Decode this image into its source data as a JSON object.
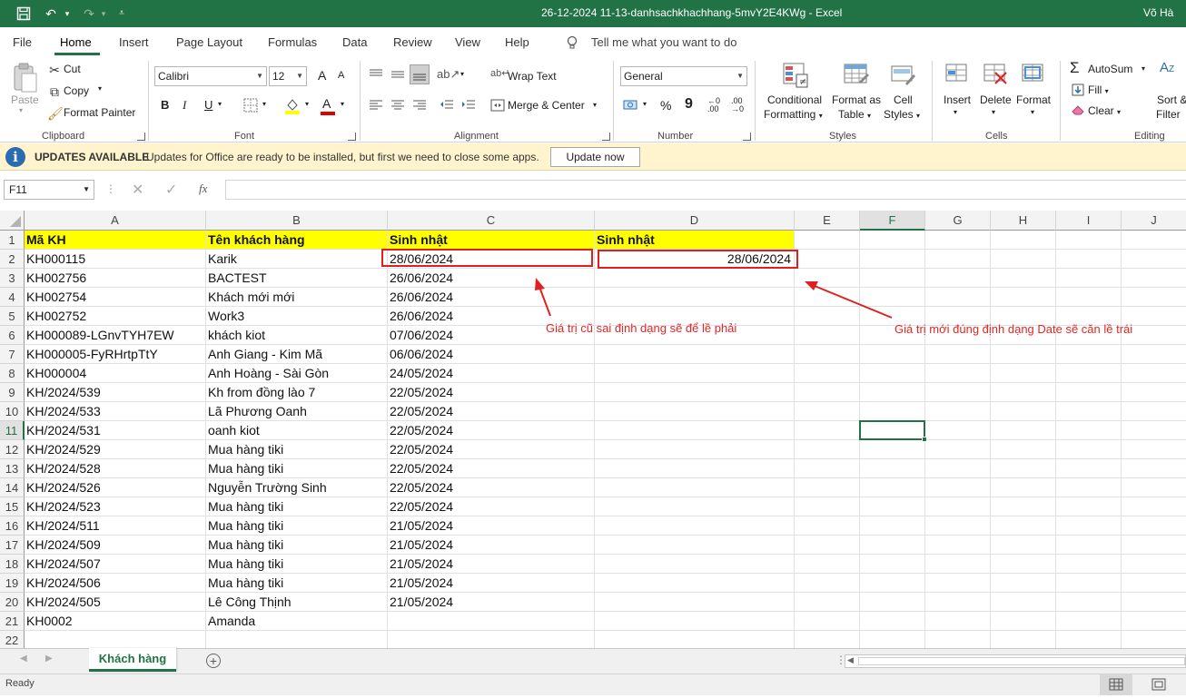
{
  "window": {
    "title": "26-12-2024 11-13-danhsachkhachhang-5mvY2E4KWg  -  Excel",
    "user": "Võ Hà"
  },
  "tabs": [
    "File",
    "Home",
    "Insert",
    "Page Layout",
    "Formulas",
    "Data",
    "Review",
    "View",
    "Help"
  ],
  "tell_me": "Tell me what you want to do",
  "ribbon": {
    "clipboard": {
      "paste": "Paste",
      "cut": "Cut",
      "copy": "Copy",
      "format_painter": "Format Painter",
      "group": "Clipboard"
    },
    "font": {
      "name": "Calibri",
      "size": "12",
      "bold": "B",
      "italic": "I",
      "underline": "U",
      "grow": "A",
      "shrink": "A",
      "color_glyph": "A",
      "group": "Font"
    },
    "alignment": {
      "wrap_text": "Wrap Text",
      "merge_center": "Merge & Center",
      "group": "Alignment"
    },
    "number": {
      "format": "General",
      "percent": "%",
      "comma": "9",
      "group": "Number"
    },
    "styles": {
      "conditional_formatting_1": "Conditional",
      "conditional_formatting_2": "Formatting",
      "format_as_table_1": "Format as",
      "format_as_table_2": "Table",
      "cell_styles_1": "Cell",
      "cell_styles_2": "Styles",
      "group": "Styles"
    },
    "cells": {
      "insert": "Insert",
      "delete": "Delete",
      "format": "Format",
      "group": "Cells"
    },
    "editing": {
      "autosum": "AutoSum",
      "fill": "Fill",
      "clear": "Clear",
      "sort_1": "Sort &",
      "sort_2": "Filter",
      "group": "Editing"
    }
  },
  "update_bar": {
    "title": "UPDATES AVAILABLE",
    "message": "Updates for Office are ready to be installed, but first we need to close some apps.",
    "button": "Update now"
  },
  "formula_bar": {
    "name_box": "F11",
    "fx": "fx",
    "value": ""
  },
  "columns": [
    "A",
    "B",
    "C",
    "D",
    "E",
    "F",
    "G",
    "H",
    "I",
    "J"
  ],
  "rows": [
    {
      "n": "1",
      "a": "Mã KH",
      "b": "Tên khách hàng",
      "c": "Sinh nhật",
      "d": "Sinh nhật"
    },
    {
      "n": "2",
      "a": "KH000115",
      "b": "Karik",
      "c": "28/06/2024",
      "d": "28/06/2024"
    },
    {
      "n": "3",
      "a": "KH002756",
      "b": "BACTEST",
      "c": "26/06/2024",
      "d": ""
    },
    {
      "n": "4",
      "a": "KH002754",
      "b": "Khách mới mới",
      "c": "26/06/2024",
      "d": ""
    },
    {
      "n": "5",
      "a": "KH002752",
      "b": "Work3",
      "c": "26/06/2024",
      "d": ""
    },
    {
      "n": "6",
      "a": "KH000089-LGnvTYH7EW",
      "b": "khách  kiot",
      "c": "07/06/2024",
      "d": ""
    },
    {
      "n": "7",
      "a": "KH000005-FyRHrtpTtY",
      "b": "Anh Giang - Kim Mã",
      "c": "06/06/2024",
      "d": ""
    },
    {
      "n": "8",
      "a": "KH000004",
      "b": "Anh Hoàng - Sài Gòn",
      "c": "24/05/2024",
      "d": ""
    },
    {
      "n": "9",
      "a": "KH/2024/539",
      "b": "Kh from đồng lào 7",
      "c": "22/05/2024",
      "d": ""
    },
    {
      "n": "10",
      "a": "KH/2024/533",
      "b": "Lã Phương Oanh",
      "c": "22/05/2024",
      "d": ""
    },
    {
      "n": "11",
      "a": "KH/2024/531",
      "b": "oanh kiot",
      "c": "22/05/2024",
      "d": ""
    },
    {
      "n": "12",
      "a": "KH/2024/529",
      "b": "Mua hàng tiki",
      "c": "22/05/2024",
      "d": ""
    },
    {
      "n": "13",
      "a": "KH/2024/528",
      "b": "Mua hàng tiki",
      "c": "22/05/2024",
      "d": ""
    },
    {
      "n": "14",
      "a": "KH/2024/526",
      "b": "Nguyễn Trường Sinh",
      "c": "22/05/2024",
      "d": ""
    },
    {
      "n": "15",
      "a": "KH/2024/523",
      "b": "Mua hàng tiki",
      "c": "22/05/2024",
      "d": ""
    },
    {
      "n": "16",
      "a": "KH/2024/511",
      "b": "Mua hàng tiki",
      "c": "21/05/2024",
      "d": ""
    },
    {
      "n": "17",
      "a": "KH/2024/509",
      "b": "Mua hàng tiki",
      "c": "21/05/2024",
      "d": ""
    },
    {
      "n": "18",
      "a": "KH/2024/507",
      "b": "Mua hàng tiki",
      "c": "21/05/2024",
      "d": ""
    },
    {
      "n": "19",
      "a": "KH/2024/506",
      "b": "Mua hàng tiki",
      "c": "21/05/2024",
      "d": ""
    },
    {
      "n": "20",
      "a": "KH/2024/505",
      "b": "Lê Công Thịnh",
      "c": "21/05/2024",
      "d": ""
    },
    {
      "n": "21",
      "a": "KH0002",
      "b": "Amanda",
      "c": "",
      "d": ""
    },
    {
      "n": "22",
      "a": "",
      "b": "",
      "c": "",
      "d": ""
    }
  ],
  "annotations": {
    "left": "Giá trị cũ sai định dạng sẽ để lề phải",
    "right": "Giá trị mới đúng định dạng Date sẽ căn lề trái",
    "color": "#e32626"
  },
  "sheet_tab": "Khách hàng",
  "status": "Ready",
  "colors": {
    "excel_green": "#217346",
    "header_fill": "#ffff00",
    "update_bar": "#fff4ce"
  }
}
